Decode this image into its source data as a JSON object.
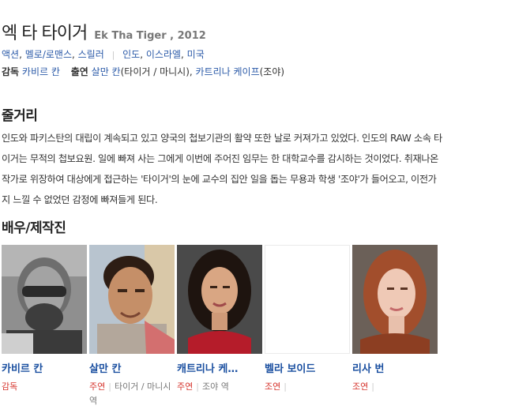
{
  "movie": {
    "title": "엑 타 타이거",
    "original_title": "Ek Tha Tiger , 2012",
    "genres": [
      "액션",
      "멜로/로맨스",
      "스릴러"
    ],
    "countries": [
      "인도",
      "이스라엘",
      "미국"
    ],
    "director_label": "감독",
    "director": "카비르 칸",
    "cast_label": "출연",
    "cast_1": "살만 칸",
    "cast_1_role": "(타이거 / 마니시)",
    "cast_2": "카트리나 케이프",
    "cast_2_role": "(조야)"
  },
  "synopsis": {
    "heading": "줄거리",
    "line1": "인도와 파키스탄의 대립이 계속되고 있고 양국의 첩보기관의 활약 또한 날로 커져가고 있었다. 인도의 RAW 소속 타",
    "line2": "이거는 무적의 첩보요원. 일에 빠져 사는 그에게 이번에 주어진 임무는 한 대학교수를 감시하는 것이었다. 취재나온",
    "line3": "작가로 위장하여 대상에게 접근하는 '타이거'의 눈에 교수의 집안 일을 돕는 무용과 학생 '조야'가 들어오고, 이전가",
    "line4": "지 느낄 수 없었던 감정에 빠져들게 된다."
  },
  "cast": {
    "heading": "배우/제작진",
    "people": [
      {
        "name": "카비르 칸",
        "kind": "감독",
        "role": ""
      },
      {
        "name": "살만 칸",
        "kind": "주연",
        "role": "타이거 / 마니시 역"
      },
      {
        "name": "캐트리나 케…",
        "kind": "주연",
        "role": "조야 역"
      },
      {
        "name": "벨라 보이드",
        "kind": "조연",
        "role": ""
      },
      {
        "name": "리사 번",
        "kind": "조연",
        "role": ""
      }
    ]
  },
  "colors": {
    "link": "#2b5aa8",
    "name": "#1a4fa0",
    "role_kind": "#d6352e"
  },
  "icons": [
    "portrait-photo"
  ]
}
